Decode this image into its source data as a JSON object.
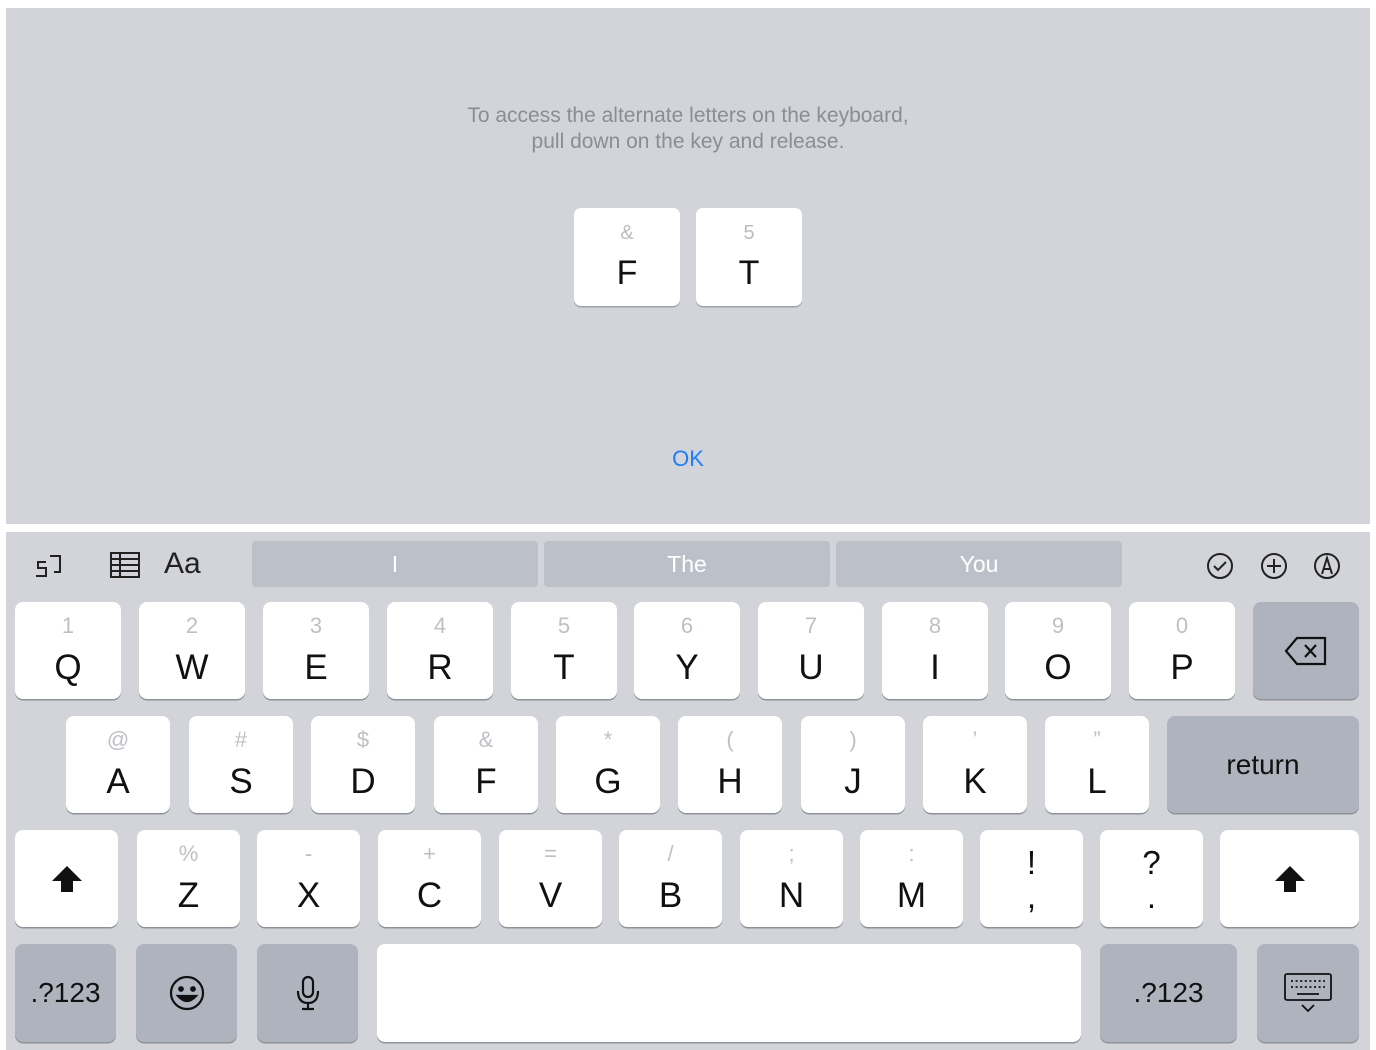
{
  "overlay": {
    "instruction_line1": "To access the alternate letters on the keyboard,",
    "instruction_line2": "pull down on the key and release.",
    "demo_keys": [
      {
        "alt": "&",
        "main": "F"
      },
      {
        "alt": "5",
        "main": "T"
      }
    ],
    "ok_label": "OK"
  },
  "toolbar": {
    "left_icons": [
      "undo-shortcut-icon",
      "table-icon",
      "format-text-icon"
    ],
    "format_label": "Aa",
    "suggestions": [
      "I",
      "The",
      "You"
    ],
    "right_icons": [
      "checklist-icon",
      "add-icon",
      "markup-icon"
    ]
  },
  "rows": {
    "row1": [
      {
        "alt": "1",
        "main": "Q"
      },
      {
        "alt": "2",
        "main": "W"
      },
      {
        "alt": "3",
        "main": "E"
      },
      {
        "alt": "4",
        "main": "R"
      },
      {
        "alt": "5",
        "main": "T"
      },
      {
        "alt": "6",
        "main": "Y"
      },
      {
        "alt": "7",
        "main": "U"
      },
      {
        "alt": "8",
        "main": "I"
      },
      {
        "alt": "9",
        "main": "O"
      },
      {
        "alt": "0",
        "main": "P"
      }
    ],
    "row2": [
      {
        "alt": "@",
        "main": "A"
      },
      {
        "alt": "#",
        "main": "S"
      },
      {
        "alt": "$",
        "main": "D"
      },
      {
        "alt": "&",
        "main": "F"
      },
      {
        "alt": "*",
        "main": "G"
      },
      {
        "alt": "(",
        "main": "H"
      },
      {
        "alt": ")",
        "main": "J"
      },
      {
        "alt": "’",
        "main": "K"
      },
      {
        "alt": "”",
        "main": "L"
      }
    ],
    "row3": [
      {
        "alt": "%",
        "main": "Z"
      },
      {
        "alt": "-",
        "main": "X"
      },
      {
        "alt": "+",
        "main": "C"
      },
      {
        "alt": "=",
        "main": "V"
      },
      {
        "alt": "/",
        "main": "B"
      },
      {
        "alt": ";",
        "main": "N"
      },
      {
        "alt": ":",
        "main": "M"
      }
    ],
    "punct": [
      {
        "top": "!",
        "bottom": ","
      },
      {
        "top": "?",
        "bottom": "."
      }
    ]
  },
  "special": {
    "return_label": "return",
    "numbers_label": ".?123"
  },
  "colors": {
    "background": "#d2d4d9",
    "key": "#ffffff",
    "dark_key": "#aeb3bd",
    "suggestion_bar": "#bcc1c9",
    "ok_blue": "#1f7ef5"
  }
}
